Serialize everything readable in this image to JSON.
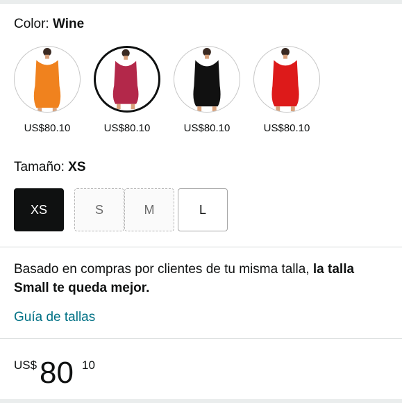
{
  "color": {
    "label": "Color:",
    "selected": "Wine",
    "swatches": [
      {
        "name": "Orange",
        "color": "#f0821e",
        "price": "US$80.10",
        "selected": false
      },
      {
        "name": "Wine",
        "color": "#b3284a",
        "price": "US$80.10",
        "selected": true
      },
      {
        "name": "Black",
        "color": "#111111",
        "price": "US$80.10",
        "selected": false
      },
      {
        "name": "Red",
        "color": "#dd1a1a",
        "price": "US$80.10",
        "selected": false
      }
    ]
  },
  "size": {
    "label": "Tamaño:",
    "selected": "XS",
    "options": [
      {
        "label": "XS",
        "state": "selected"
      },
      {
        "label": "S",
        "state": "unavailable"
      },
      {
        "label": "M",
        "state": "unavailable"
      },
      {
        "label": "L",
        "state": "available"
      }
    ]
  },
  "fit": {
    "text": "Basado en compras por clientes de tu misma talla, ",
    "bold": "la talla Small te queda mejor."
  },
  "size_guide": "Guía de tallas",
  "price": {
    "currency": "US$",
    "whole": "80",
    "fraction": "10"
  }
}
